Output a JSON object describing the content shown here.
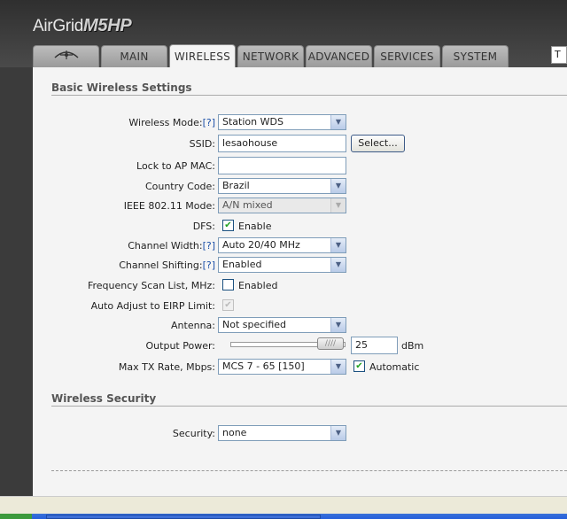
{
  "brand": {
    "name": "AirGrid",
    "model": "M5HP"
  },
  "tabs": [
    {
      "label": "",
      "icon": "ubiquiti-logo-icon"
    },
    {
      "label": "MAIN"
    },
    {
      "label": "WIRELESS",
      "active": true
    },
    {
      "label": "NETWORK"
    },
    {
      "label": "ADVANCED"
    },
    {
      "label": "SERVICES"
    },
    {
      "label": "SYSTEM"
    }
  ],
  "right_box_text": "T",
  "basic": {
    "title": "Basic Wireless Settings",
    "help": "[?]",
    "wireless_mode": {
      "label": "Wireless Mode:",
      "value": "Station WDS"
    },
    "ssid": {
      "label": "SSID:",
      "value": "lesaohouse",
      "button": "Select..."
    },
    "lock_ap_mac": {
      "label": "Lock to AP MAC:",
      "value": ""
    },
    "country_code": {
      "label": "Country Code:",
      "value": "Brazil"
    },
    "ieee_mode": {
      "label": "IEEE 802.11 Mode:",
      "value": "A/N mixed"
    },
    "dfs": {
      "label": "DFS:",
      "checkbox_label": "Enable",
      "checked": true
    },
    "channel_width": {
      "label": "Channel Width:",
      "value": "Auto 20/40 MHz"
    },
    "channel_shifting": {
      "label": "Channel Shifting:",
      "value": "Enabled"
    },
    "freq_scan": {
      "label": "Frequency Scan List, MHz:",
      "checkbox_label": "Enabled",
      "checked": false
    },
    "auto_adjust": {
      "label": "Auto Adjust to EIRP Limit:",
      "checked": true,
      "disabled": true
    },
    "antenna": {
      "label": "Antenna:",
      "value": "Not specified"
    },
    "output_power": {
      "label": "Output Power:",
      "value": "25",
      "unit": "dBm",
      "level": 1.0
    },
    "max_tx_rate": {
      "label": "Max TX Rate, Mbps:",
      "value": "MCS 7 - 65 [150]",
      "checkbox_label": "Automatic",
      "checked": true
    }
  },
  "security": {
    "title": "Wireless Security",
    "label": "Security:",
    "value": "none"
  }
}
